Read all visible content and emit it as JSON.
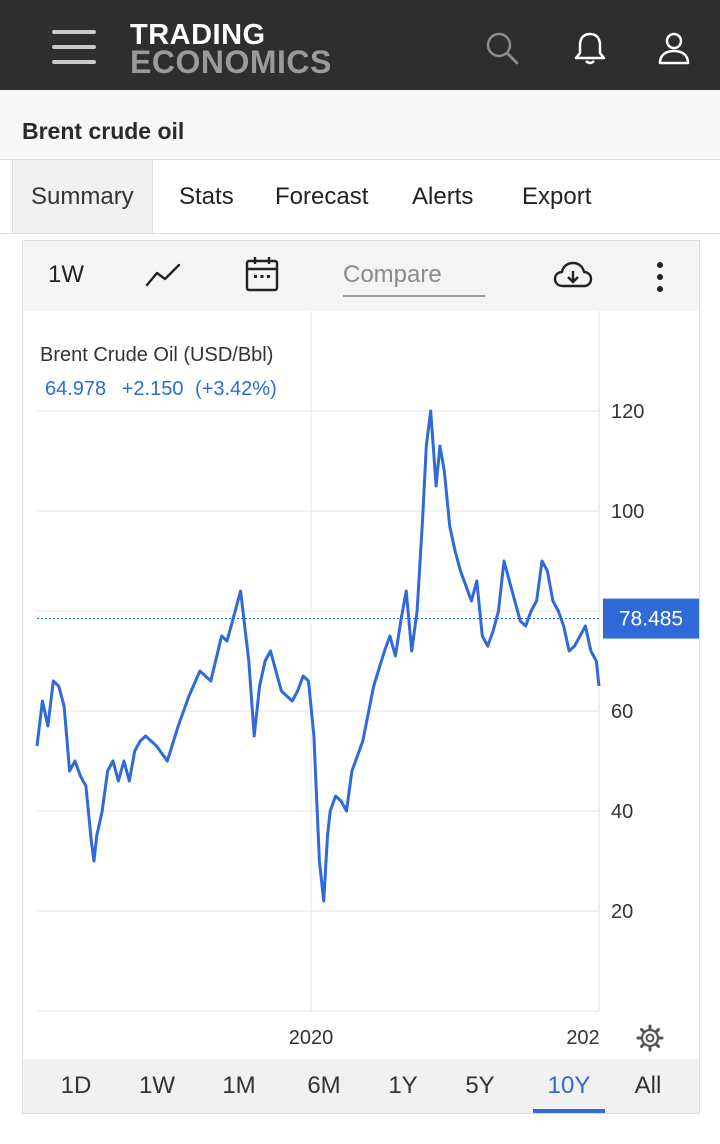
{
  "header": {
    "logo_line1": "TRADING",
    "logo_line2": "ECONOMICS",
    "icons": [
      "menu-icon",
      "search-icon",
      "bell-icon",
      "user-icon"
    ]
  },
  "page": {
    "title": "Brent crude oil"
  },
  "tabs": [
    {
      "label": "Summary",
      "active": true
    },
    {
      "label": "Stats",
      "active": false
    },
    {
      "label": "Forecast",
      "active": false
    },
    {
      "label": "Alerts",
      "active": false
    },
    {
      "label": "Export",
      "active": false
    }
  ],
  "toolbar": {
    "period": "1W",
    "compare_placeholder": "Compare",
    "icons": [
      "line-chart-icon",
      "calendar-icon",
      "download-cloud-icon",
      "more-vertical-icon"
    ]
  },
  "quote": {
    "name": "Brent Crude Oil (USD/Bbl)",
    "value": "64.978",
    "change": "+2.150",
    "change_pct": "(+3.42%)",
    "last_label": "78.485"
  },
  "range_buttons": [
    {
      "label": "1D",
      "active": false
    },
    {
      "label": "1W",
      "active": false
    },
    {
      "label": "1M",
      "active": false
    },
    {
      "label": "6M",
      "active": false
    },
    {
      "label": "1Y",
      "active": false
    },
    {
      "label": "5Y",
      "active": false
    },
    {
      "label": "10Y",
      "active": true
    },
    {
      "label": "All",
      "active": false
    }
  ],
  "colors": {
    "header_bg": "#2e2e2e",
    "line": "#2f6ad8",
    "accent": "#2f6ad8"
  },
  "chart_data": {
    "type": "line",
    "title": "Brent Crude Oil (USD/Bbl)",
    "xlabel": "",
    "ylabel": "",
    "x_tick_labels": [
      "2020",
      "202"
    ],
    "y_ticks": [
      20,
      40,
      60,
      80,
      100,
      120
    ],
    "y_tick_labels": [
      "20",
      "40",
      "60",
      "",
      "100",
      "120"
    ],
    "ylim": [
      0,
      140
    ],
    "grid": true,
    "last_value": 78.485,
    "series": [
      {
        "x": [
          2015.0,
          2015.1,
          2015.2,
          2015.3,
          2015.4,
          2015.5,
          2015.6,
          2015.7,
          2015.8,
          2015.9,
          2016.0,
          2016.05,
          2016.1,
          2016.2,
          2016.3,
          2016.4,
          2016.5,
          2016.6,
          2016.7,
          2016.8,
          2016.9,
          2017.0,
          2017.2,
          2017.4,
          2017.6,
          2017.8,
          2018.0,
          2018.2,
          2018.4,
          2018.5,
          2018.6,
          2018.75,
          2018.9,
          2019.0,
          2019.1,
          2019.2,
          2019.3,
          2019.4,
          2019.5,
          2019.6,
          2019.7,
          2019.8,
          2019.9,
          2020.0,
          2020.1,
          2020.2,
          2020.28,
          2020.35,
          2020.4,
          2020.5,
          2020.6,
          2020.7,
          2020.8,
          2020.9,
          2021.0,
          2021.2,
          2021.4,
          2021.5,
          2021.6,
          2021.7,
          2021.8,
          2021.9,
          2022.0,
          2022.1,
          2022.17,
          2022.25,
          2022.35,
          2022.42,
          2022.5,
          2022.6,
          2022.7,
          2022.8,
          2022.9,
          2023.0,
          2023.1,
          2023.2,
          2023.3,
          2023.4,
          2023.5,
          2023.6,
          2023.7,
          2023.8,
          2023.9,
          2024.0,
          2024.1,
          2024.2,
          2024.3,
          2024.4,
          2024.5,
          2024.6,
          2024.7,
          2024.8,
          2024.9,
          2025.0,
          2025.1,
          2025.2,
          2025.3,
          2025.35
        ],
        "values": [
          53,
          62,
          57,
          66,
          65,
          61,
          48,
          50,
          47,
          45,
          34,
          30,
          35,
          40,
          48,
          50,
          46,
          50,
          46,
          52,
          54,
          55,
          53,
          50,
          57,
          63,
          68,
          66,
          75,
          74,
          78,
          84,
          70,
          55,
          65,
          70,
          72,
          68,
          64,
          63,
          62,
          64,
          67,
          66,
          55,
          30,
          22,
          35,
          40,
          43,
          42,
          40,
          48,
          51,
          54,
          65,
          72,
          75,
          71,
          78,
          84,
          72,
          80,
          98,
          113,
          120,
          105,
          113,
          108,
          97,
          92,
          88,
          85,
          82,
          86,
          75,
          73,
          76,
          80,
          90,
          86,
          82,
          78,
          77,
          80,
          82,
          90,
          88,
          82,
          80,
          77,
          72,
          73,
          75,
          77,
          72,
          70,
          65
        ]
      }
    ]
  }
}
